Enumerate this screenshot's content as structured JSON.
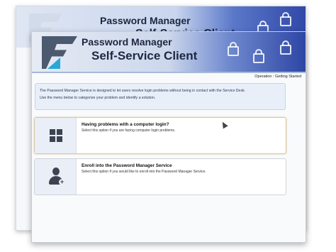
{
  "back_window": {
    "title_line1": "Password Manager",
    "title_line2": "Self-Service Client"
  },
  "front_window": {
    "title_line1": "Password Manager",
    "title_line2": "Self-Service Client",
    "breadcrumb": "Operation : Getting Started",
    "info": {
      "line1": "The Password Manager Service is designed to let users resolve login problems without being in contact with the Service Desk.",
      "line2": "Use the menu below to categorize your problem and identify a solution."
    },
    "options": [
      {
        "title": "Having problems with a computer login?",
        "description": "Select this option if you are facing computer login problems.",
        "icon": "windows-icon"
      },
      {
        "title": "Enroll into the Password Manager Service",
        "description": "Select this option if you would like to enroll into the Password Manager Service.",
        "icon": "user-add-icon"
      }
    ]
  },
  "colors": {
    "header_gradient_end": "#2d46a5",
    "logo_dark": "#4b5a6e",
    "logo_accent": "#28a8d8"
  }
}
